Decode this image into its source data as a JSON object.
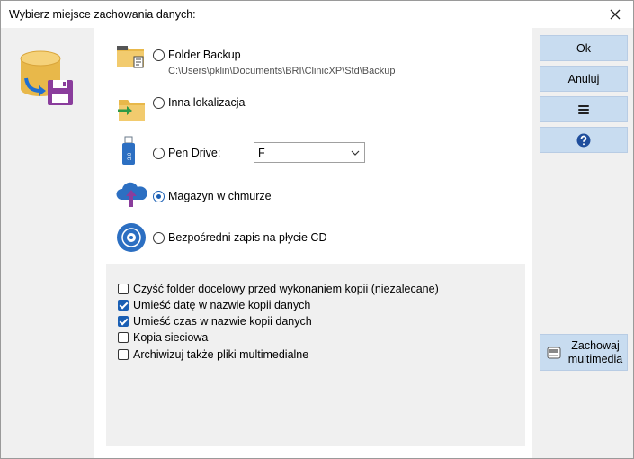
{
  "window": {
    "title": "Wybierz miejsce zachowania danych:"
  },
  "options": [
    {
      "label": "Folder Backup",
      "path": "C:\\Users\\pklin\\Documents\\BRI\\ClinicXP\\Std\\Backup",
      "checked": false,
      "icon": "folder-backup-icon"
    },
    {
      "label": "Inna lokalizacja",
      "checked": false,
      "icon": "folder-arrow-icon"
    },
    {
      "label": "Pen Drive:",
      "checked": false,
      "icon": "usb-drive-icon"
    },
    {
      "label": "Magazyn w chmurze",
      "checked": true,
      "icon": "cloud-upload-icon"
    },
    {
      "label": "Bezpośredni zapis na płycie CD",
      "checked": false,
      "icon": "cd-disc-icon"
    }
  ],
  "pen_drive_select": {
    "value": "F"
  },
  "checkboxes": [
    {
      "label": "Czyść folder docelowy przed wykonaniem kopii (niezalecane)",
      "checked": false
    },
    {
      "label": "Umieść datę w nazwie kopii danych",
      "checked": true
    },
    {
      "label": "Umieść czas w nazwie kopii danych",
      "checked": true
    },
    {
      "label": "Kopia sieciowa",
      "checked": false
    },
    {
      "label": "Archiwizuj także pliki multimedialne",
      "checked": false
    }
  ],
  "buttons": {
    "ok": "Ok",
    "cancel": "Anuluj",
    "menu_icon": "hamburger-icon",
    "help_icon": "help-icon",
    "save_media": "Zachowaj multimedia"
  },
  "colors": {
    "button_bg": "#c8dcf0",
    "accent": "#1a5fb4",
    "panel_bg": "#f0f0f0"
  }
}
